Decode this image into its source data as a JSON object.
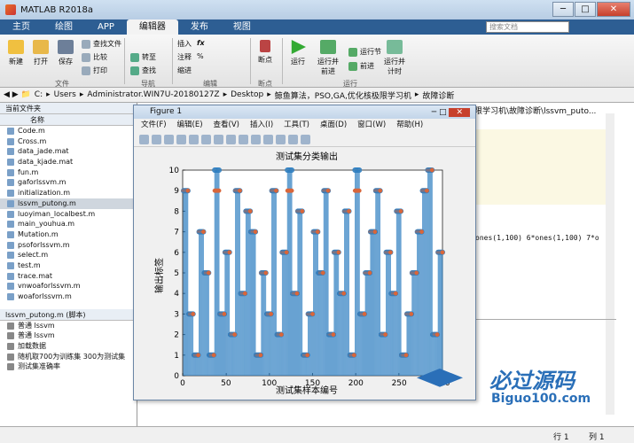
{
  "window": {
    "title": "MATLAB R2018a",
    "min": "─",
    "max": "□",
    "close": "✕"
  },
  "tabs": [
    "主页",
    "绘图",
    "APP",
    "编辑器",
    "发布",
    "视图"
  ],
  "search": {
    "placeholder": "搜索文档"
  },
  "ribbon": {
    "file_buttons": [
      "新建",
      "打开",
      "保存"
    ],
    "file_small": [
      "查找文件",
      "比较",
      "打印"
    ],
    "nav": [
      "转至",
      "查找"
    ],
    "edit": [
      "插入",
      "注释",
      "缩进"
    ],
    "breakpoint": "断点",
    "run": [
      "运行",
      "运行并\n前进",
      "运行节",
      "前进",
      "运行并\n计时"
    ],
    "groups": [
      "文件",
      "导航",
      "编辑",
      "断点",
      "运行"
    ]
  },
  "address": {
    "path": [
      "C:",
      "Users",
      "Administrator.WIN7U-20180127Z",
      "Desktop",
      "鲸鱼算法，PSO,GA,优化核极限学习机",
      "故障诊断"
    ]
  },
  "left": {
    "header": "当前文件夹",
    "col": "名称",
    "files": [
      "Code.m",
      "Cross.m",
      "data_jade.mat",
      "data_kjade.mat",
      "fun.m",
      "gaforlssvm.m",
      "initialization.m",
      "lssvm_putong.m",
      "luoyiman_localbest.m",
      "main_youhua.m",
      "Mutation.m",
      "psoforlssvm.m",
      "select.m",
      "test.m",
      "trace.mat",
      "vnwoaforlssvm.m",
      "woaforlssvm.m"
    ],
    "selected": 7,
    "detail_header": "lssvm_putong.m  (脚本)",
    "detail": [
      "普通 lssvm",
      "普通 lssvm",
      "加载数据",
      "随机取700为训练集 300为测试集",
      "测试集准确率"
    ]
  },
  "editor": {
    "path_tail": "限学习机\\故障诊断\\lssvm_puto...",
    "code": "ones(1,100) 6*ones(1,100) 7*o"
  },
  "figure": {
    "title": "Figure 1",
    "menus": [
      "文件(F)",
      "编辑(E)",
      "查看(V)",
      "插入(I)",
      "工具(T)",
      "桌面(D)",
      "窗口(W)",
      "帮助(H)"
    ]
  },
  "chart_data": {
    "type": "scatter",
    "title": "测试集分类输出",
    "xlabel": "测试集样本编号",
    "ylabel": "输出标签",
    "xlim": [
      0,
      300
    ],
    "ylim": [
      0,
      10
    ],
    "xticks": [
      0,
      50,
      100,
      150,
      200,
      250,
      300
    ],
    "yticks": [
      0,
      1,
      2,
      3,
      4,
      5,
      6,
      7,
      8,
      9,
      10
    ],
    "series": [
      {
        "values": [
          9,
          3,
          1,
          7,
          5,
          1,
          10,
          3,
          6,
          2,
          9,
          4,
          8,
          7,
          1,
          5,
          3,
          9,
          2,
          6,
          10,
          4,
          8,
          1,
          3,
          7,
          5,
          9,
          2,
          6,
          4,
          8,
          1,
          10,
          3,
          5,
          7,
          9,
          2,
          6,
          4,
          8,
          1,
          3,
          5,
          7,
          9,
          10,
          2,
          6
        ],
        "color": "#2f7fc1"
      },
      {
        "values": [
          9,
          3,
          1,
          7,
          5,
          1,
          9,
          3,
          6,
          2,
          9,
          4,
          8,
          7,
          1,
          5,
          3,
          9,
          2,
          6,
          9,
          4,
          8,
          1,
          3,
          7,
          5,
          9,
          2,
          6,
          4,
          8,
          1,
          9,
          3,
          5,
          7,
          9,
          2,
          6,
          4,
          8,
          1,
          3,
          5,
          7,
          9,
          10,
          2,
          6
        ],
        "color": "#d9663a"
      }
    ],
    "x_step": 6
  },
  "status": {
    "row": "行 1",
    "col": "列 1"
  },
  "watermark": {
    "big": "必过源码",
    "small": "Biguo100.com"
  }
}
